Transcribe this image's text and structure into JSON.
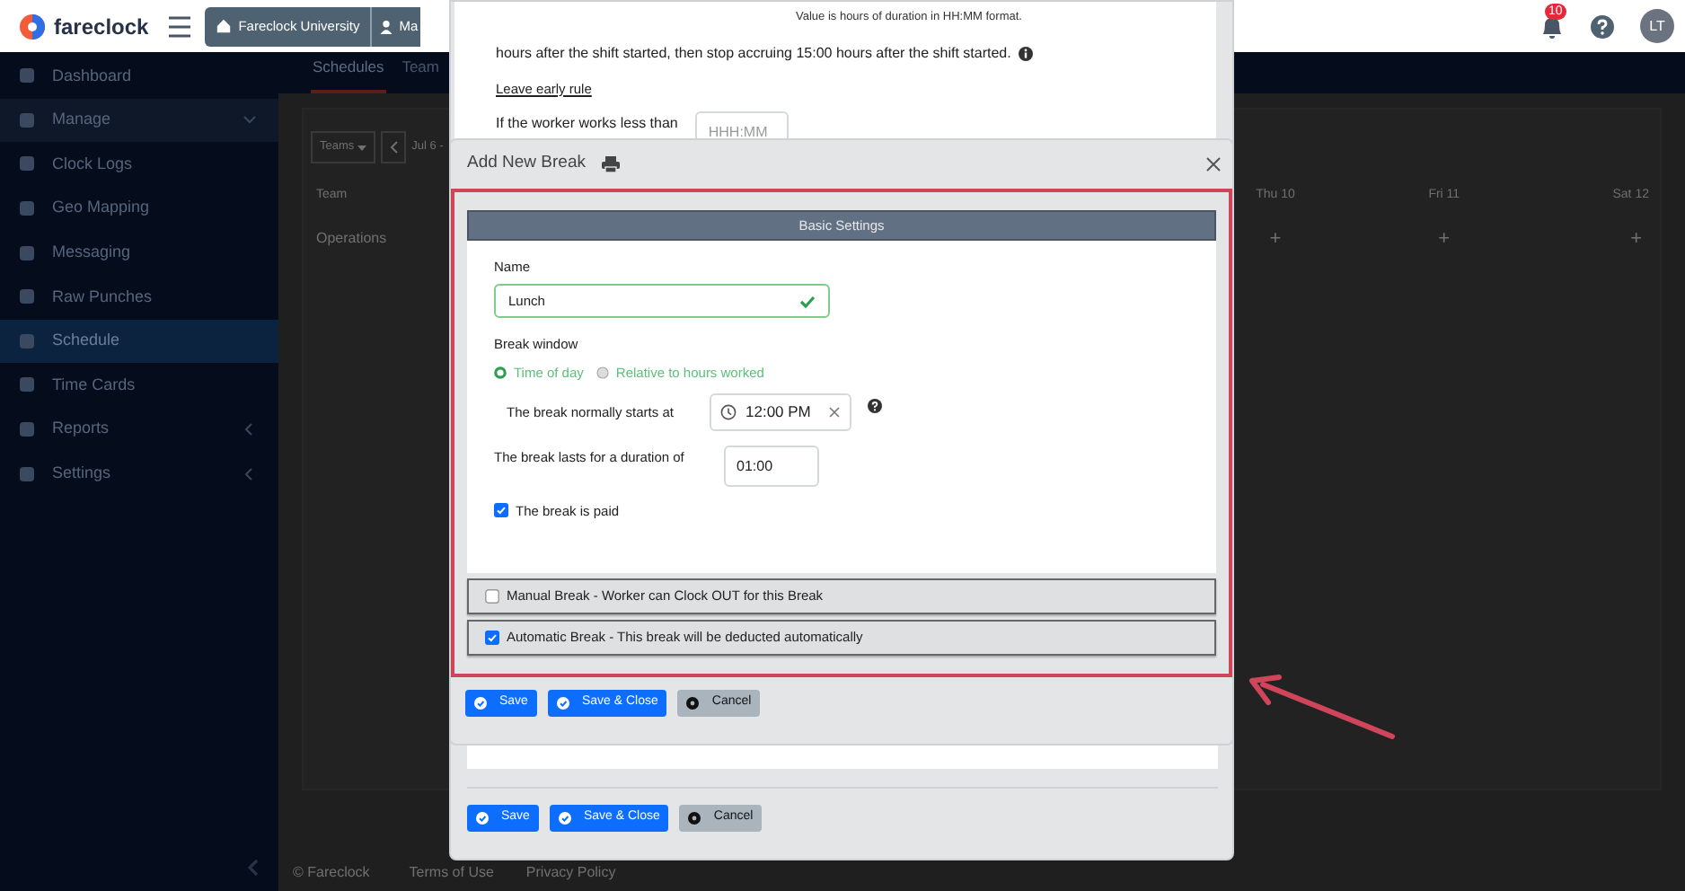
{
  "header": {
    "logo": "fareclock",
    "breadcrumbs": [
      {
        "label": "Fareclock University"
      },
      {
        "label": "Ma"
      }
    ],
    "notification_count": "10",
    "avatar": "LT"
  },
  "sidebar": {
    "items": [
      {
        "label": "Dashboard",
        "selected": false,
        "kind": "link"
      },
      {
        "label": "Manage",
        "selected": false,
        "kind": "group",
        "expanded": true
      },
      {
        "label": "Clock Logs",
        "selected": false,
        "kind": "link"
      },
      {
        "label": "Geo Mapping",
        "selected": false,
        "kind": "link"
      },
      {
        "label": "Messaging",
        "selected": false,
        "kind": "link"
      },
      {
        "label": "Raw Punches",
        "selected": false,
        "kind": "link"
      },
      {
        "label": "Schedule",
        "selected": true,
        "kind": "link"
      },
      {
        "label": "Time Cards",
        "selected": false,
        "kind": "link"
      },
      {
        "label": "Reports",
        "selected": false,
        "kind": "group",
        "expanded": false
      },
      {
        "label": "Settings",
        "selected": false,
        "kind": "group",
        "expanded": false
      }
    ]
  },
  "page": {
    "tabs": [
      {
        "label": "Schedules",
        "selected": true
      },
      {
        "label": "Team",
        "selected": false
      }
    ],
    "filter": "Teams",
    "date_range": "Jul 6 -",
    "table": {
      "columns": [
        "Team",
        "Thu 10",
        "Fri 11",
        "Sat 12"
      ],
      "rows": [
        {
          "cells": [
            "Operations",
            "+",
            "+",
            "+"
          ]
        }
      ]
    },
    "footer": [
      "© Fareclock",
      "Terms of Use",
      "Privacy Policy"
    ]
  },
  "background_dialog": {
    "note": "Value is hours of duration in HH:MM format.",
    "rule_text": "hours after the shift started, then stop accruing 15:00 hours after the shift started.",
    "section_link": "Leave early rule",
    "field_label": "If the worker works less than",
    "field_placeholder": "HHH:MM",
    "buttons": [
      {
        "label": "Save",
        "kind": "primary"
      },
      {
        "label": "Save & Close",
        "kind": "primary"
      },
      {
        "label": "Cancel",
        "kind": "secondary"
      }
    ]
  },
  "dialog": {
    "title": "Add New Break",
    "section_title": "Basic Settings",
    "name_label": "Name",
    "name_value": "Lunch",
    "window_label": "Break window",
    "window_options": [
      {
        "label": "Time of day",
        "selected": true
      },
      {
        "label": "Relative to hours worked",
        "selected": false
      }
    ],
    "start_label": "The break normally starts at",
    "start_value": "12:00 PM",
    "duration_label": "The break lasts for a duration of",
    "duration_value": "01:00",
    "paid": {
      "label": "The break is paid",
      "checked": true
    },
    "break_types": [
      {
        "label": "Manual Break - Worker can Clock OUT for this Break",
        "checked": false
      },
      {
        "label": "Automatic Break - This break will be deducted automatically",
        "checked": true
      }
    ],
    "buttons": [
      {
        "label": "Save",
        "kind": "primary"
      },
      {
        "label": "Save & Close",
        "kind": "primary"
      },
      {
        "label": "Cancel",
        "kind": "secondary"
      }
    ]
  }
}
